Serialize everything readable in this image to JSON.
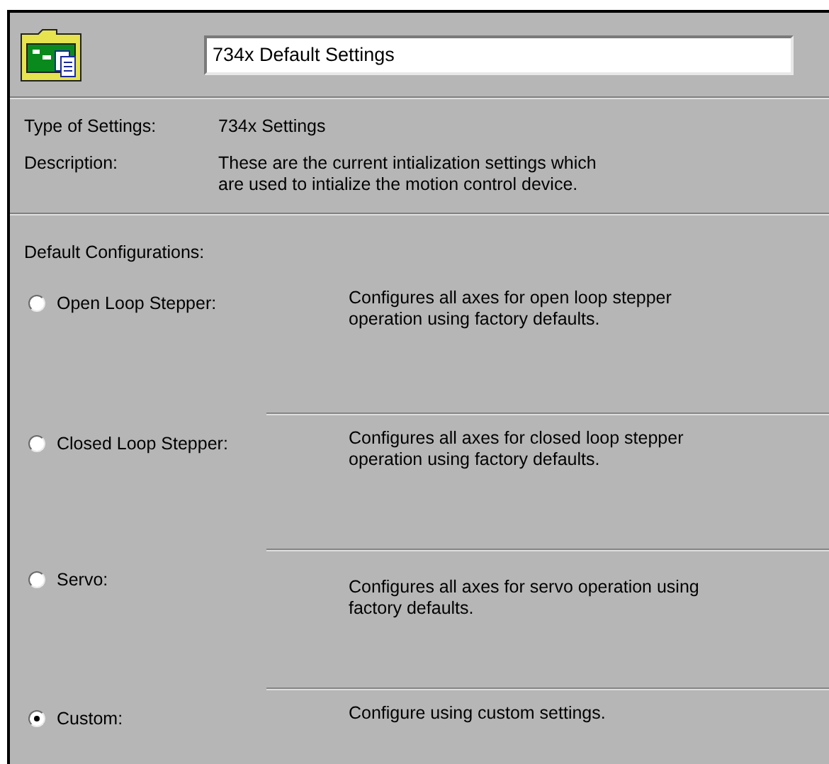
{
  "header": {
    "name_value": "734x Default Settings"
  },
  "info": [
    {
      "label": "Type of Settings:",
      "value": "734x Settings"
    },
    {
      "label": "Description:",
      "value": "These are the current intialization settings which\nare used to intialize the motion control device."
    }
  ],
  "configurations": {
    "title": "Default Configurations:",
    "options": [
      {
        "label": "Open Loop Stepper:",
        "description": "Configures all axes for open loop stepper\noperation using factory defaults.",
        "selected": false
      },
      {
        "label": "Closed Loop Stepper:",
        "description": "Configures all axes for closed loop stepper\noperation using factory defaults.",
        "selected": false
      },
      {
        "label": "Servo:",
        "description": "Configures all axes for servo operation using\nfactory defaults.",
        "selected": false
      },
      {
        "label": "Custom:",
        "description": "Configure using custom settings.",
        "selected": true
      }
    ]
  }
}
